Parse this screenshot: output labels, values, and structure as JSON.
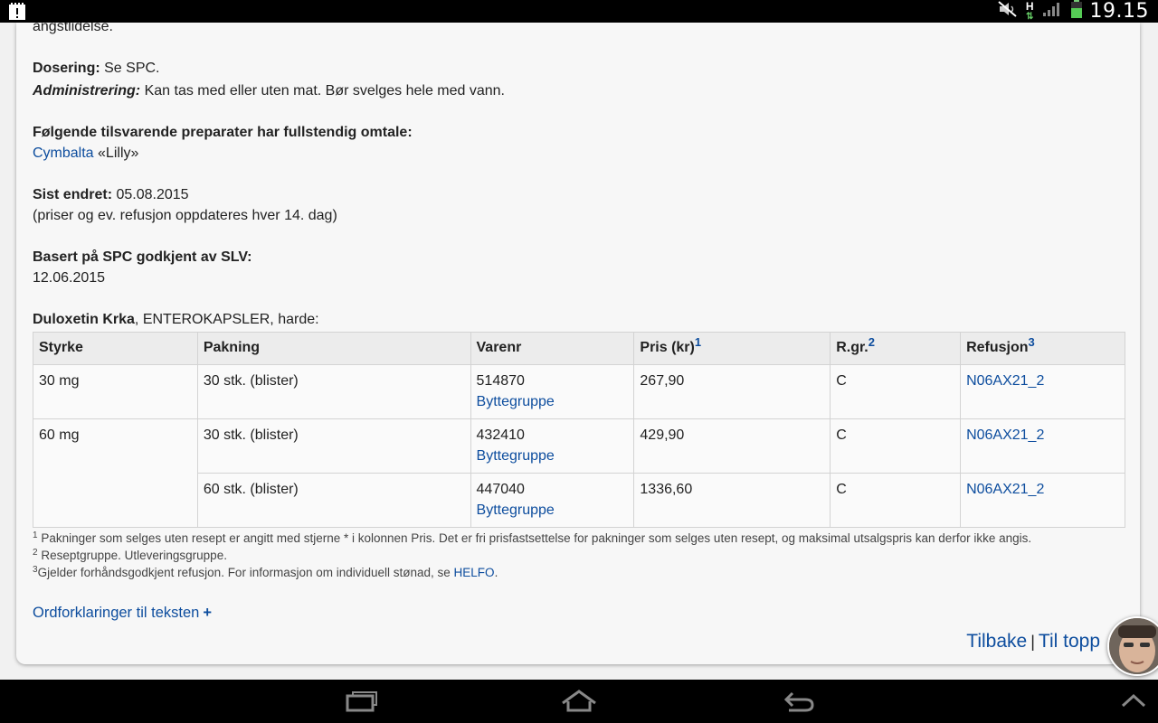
{
  "status_bar": {
    "time": "19.15",
    "network": "H",
    "icons": [
      "notification-icon",
      "mute-icon",
      "network-h-icon",
      "signal-icon",
      "battery-icon"
    ]
  },
  "content": {
    "truncated_text": "angstlidelse.",
    "dosering_label": "Dosering:",
    "dosering_value": "Se SPC.",
    "admin_label": "Administrering:",
    "admin_value": "Kan tas med eller uten mat. Bør svelges hele med vann.",
    "equivalents_heading": "Følgende tilsvarende preparater har fullstendig omtale:",
    "equivalent_link": "Cymbalta",
    "equivalent_maker": "«Lilly»",
    "changed_label": "Sist endret:",
    "changed_value": "05.08.2015",
    "changed_note": "(priser og ev. refusjon oppdateres hver 14. dag)",
    "spc_label": "Basert på SPC godkjent av SLV:",
    "spc_value": "12.06.2015",
    "product_name": "Duloxetin Krka",
    "product_form": ", ENTEROKAPSLER, harde:"
  },
  "table": {
    "headers": {
      "styrke": "Styrke",
      "pakning": "Pakning",
      "varenr": "Varenr",
      "pris": "Pris (kr)",
      "pris_fn": "1",
      "rgr": "R.gr.",
      "rgr_fn": "2",
      "refusjon": "Refusjon",
      "refusjon_fn": "3"
    },
    "rows": [
      {
        "styrke": "30 mg",
        "pakning": "30 stk. (blister)",
        "varenr": "514870",
        "bytte": "Byttegruppe",
        "pris": "267,90",
        "rgr": "C",
        "refusjon": "N06AX21_2"
      },
      {
        "styrke": "60 mg",
        "pakning": "30 stk. (blister)",
        "varenr": "432410",
        "bytte": "Byttegruppe",
        "pris": "429,90",
        "rgr": "C",
        "refusjon": "N06AX21_2"
      },
      {
        "styrke": "",
        "pakning": "60 stk. (blister)",
        "varenr": "447040",
        "bytte": "Byttegruppe",
        "pris": "1336,60",
        "rgr": "C",
        "refusjon": "N06AX21_2"
      }
    ]
  },
  "footnotes": {
    "fn1_num": "1",
    "fn1": "Pakninger som selges uten resept er angitt med stjerne * i kolonnen Pris. Det er fri prisfastsettelse for pakninger som selges uten resept, og maksimal utsalgspris kan derfor ikke angis.",
    "fn2_num": "2",
    "fn2": "Reseptgruppe. Utleveringsgruppe.",
    "fn3_num": "3",
    "fn3": "Gjelder forhåndsgodkjent refusjon. For informasjon om individuell stønad, se ",
    "fn3_link": "HELFO",
    "fn3_end": "."
  },
  "ordforklaringer": {
    "label": "Ordforklaringer til teksten",
    "plus": "+"
  },
  "bottom_nav": {
    "back": "Tilbake",
    "separator": "|",
    "top": "Til topp"
  },
  "colors": {
    "link": "#0d4d9e",
    "card_bg": "#f7f7f7",
    "page_bg": "#f1f1f1"
  }
}
